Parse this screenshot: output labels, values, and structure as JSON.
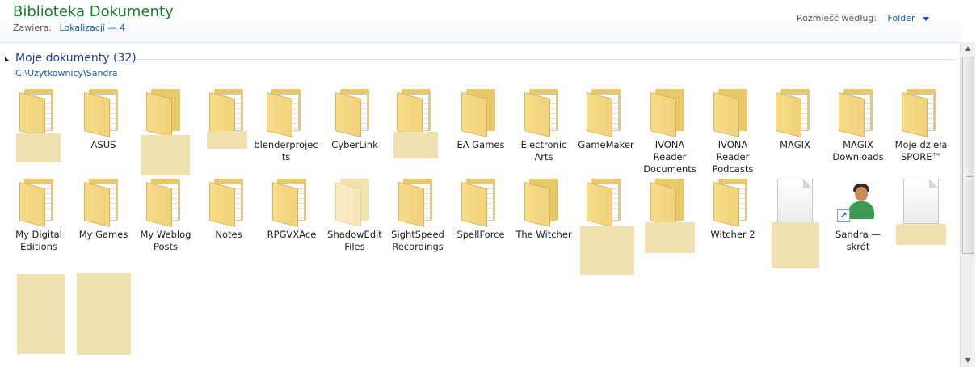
{
  "header": {
    "title": "Biblioteka Dokumenty",
    "contains_label": "Zawiera:",
    "locations_link": "Lokalizacji — 4",
    "arrange_label": "Rozmieść według:",
    "arrange_value": "Folder"
  },
  "group": {
    "title": "Moje dokumenty (32)",
    "path": "C:\\Użytkownicy\\Sandra"
  },
  "items": [
    {
      "label": "",
      "icon": "folder-icon"
    },
    {
      "label": "ASUS",
      "icon": "folder-icon"
    },
    {
      "label": "",
      "icon": "folder-icon"
    },
    {
      "label": "",
      "icon": "folder-icon"
    },
    {
      "label": "blenderprojects",
      "icon": "folder-icon"
    },
    {
      "label": "CyberLink",
      "icon": "folder-icon"
    },
    {
      "label": "",
      "icon": "folder-icon"
    },
    {
      "label": "EA Games",
      "icon": "folder-icon"
    },
    {
      "label": "Electronic Arts",
      "icon": "folder-icon"
    },
    {
      "label": "GameMaker",
      "icon": "folder-icon"
    },
    {
      "label": "IVONA Reader Documents",
      "icon": "folder-icon"
    },
    {
      "label": "IVONA Reader Podcasts",
      "icon": "folder-icon"
    },
    {
      "label": "MAGIX",
      "icon": "folder-icon"
    },
    {
      "label": "MAGIX Downloads",
      "icon": "folder-icon"
    },
    {
      "label": "Moje dzieła SPORE™",
      "icon": "folder-icon"
    },
    {
      "label": "My Digital Editions",
      "icon": "folder-icon"
    },
    {
      "label": "My Games",
      "icon": "folder-icon"
    },
    {
      "label": "My Weblog Posts",
      "icon": "folder-icon"
    },
    {
      "label": "Notes",
      "icon": "folder-icon"
    },
    {
      "label": "RPGVXAce",
      "icon": "folder-icon"
    },
    {
      "label": "ShadowEdit Files",
      "icon": "folder-icon"
    },
    {
      "label": "SightSpeed Recordings",
      "icon": "folder-icon"
    },
    {
      "label": "SpellForce",
      "icon": "folder-icon"
    },
    {
      "label": "The Witcher",
      "icon": "folder-icon"
    },
    {
      "label": "",
      "icon": "folder-icon"
    },
    {
      "label": "",
      "icon": "folder-icon"
    },
    {
      "label": "Witcher 2",
      "icon": "folder-icon"
    },
    {
      "label": "",
      "icon": "document-icon"
    },
    {
      "label": "Sandra — skrót",
      "icon": "user-shortcut-icon"
    },
    {
      "label": "",
      "icon": "document-icon"
    }
  ]
}
